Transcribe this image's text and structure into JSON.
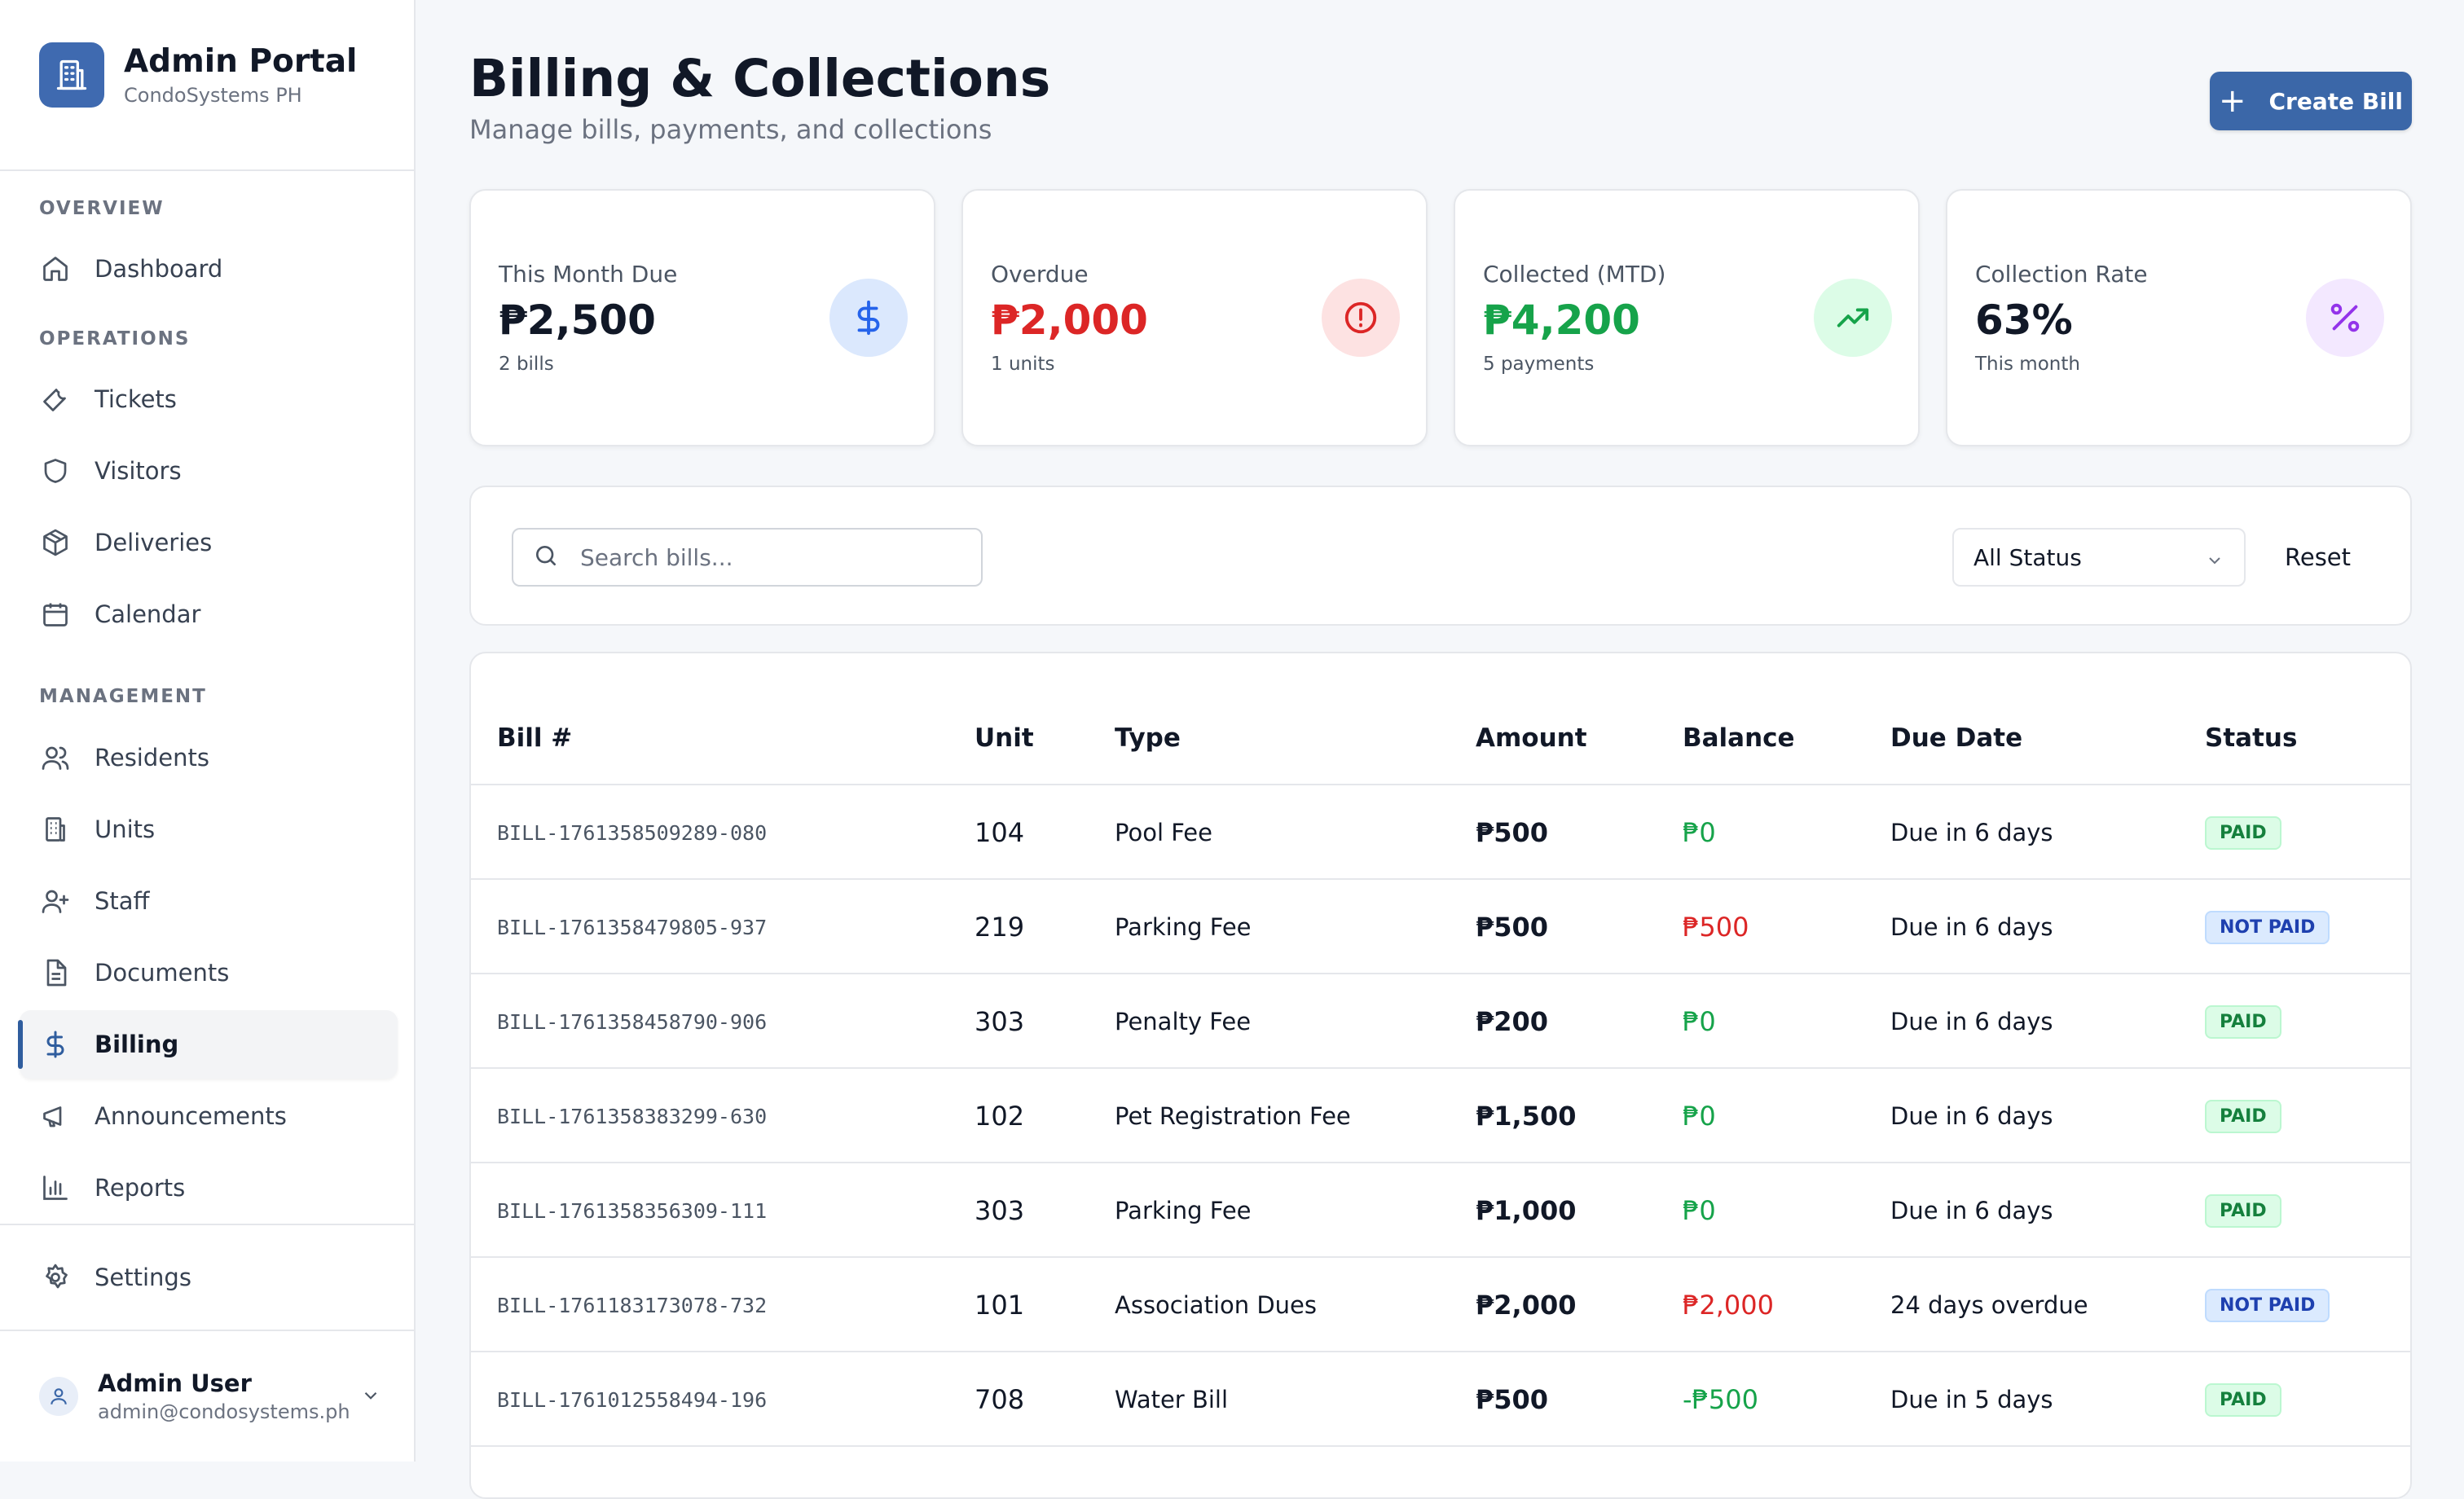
{
  "brand": {
    "title": "Admin Portal",
    "subtitle": "CondoSystems PH",
    "icon": "building-icon",
    "color": "#3f6ab0"
  },
  "sidebar": {
    "sections": [
      "OVERVIEW",
      "OPERATIONS",
      "MANAGEMENT"
    ],
    "items": [
      {
        "label": "Dashboard",
        "icon": "home-icon"
      },
      {
        "label": "Tickets",
        "icon": "wrench-icon"
      },
      {
        "label": "Visitors",
        "icon": "shield-icon"
      },
      {
        "label": "Deliveries",
        "icon": "package-icon"
      },
      {
        "label": "Calendar",
        "icon": "calendar-icon"
      },
      {
        "label": "Residents",
        "icon": "users-icon"
      },
      {
        "label": "Units",
        "icon": "building-icon"
      },
      {
        "label": "Staff",
        "icon": "user-plus-icon"
      },
      {
        "label": "Documents",
        "icon": "document-icon"
      },
      {
        "label": "Billing",
        "icon": "dollar-icon",
        "active": true
      },
      {
        "label": "Announcements",
        "icon": "megaphone-icon"
      },
      {
        "label": "Reports",
        "icon": "bar-chart-icon"
      },
      {
        "label": "Settings",
        "icon": "gear-icon"
      }
    ],
    "user": {
      "name": "Admin User",
      "email": "admin@condosystems.ph"
    }
  },
  "header": {
    "title": "Billing & Collections",
    "subtitle": "Manage bills, payments, and collections",
    "create_label": "Create Bill"
  },
  "stats": [
    {
      "label": "This Month Due",
      "value": "₱2,500",
      "sub": "2 bills",
      "icon": "dollar-icon",
      "color": "#111827",
      "icon_bg": "#dbe8fd",
      "icon_color": "#2563eb"
    },
    {
      "label": "Overdue",
      "value": "₱2,000",
      "sub": "1 units",
      "icon": "alert-circle-icon",
      "color": "#dc2626",
      "icon_bg": "#fde2e2",
      "icon_color": "#dc2626"
    },
    {
      "label": "Collected (MTD)",
      "value": "₱4,200",
      "sub": "5 payments",
      "icon": "trending-up-icon",
      "color": "#16a34a",
      "icon_bg": "#dcfce7",
      "icon_color": "#16a34a"
    },
    {
      "label": "Collection Rate",
      "value": "63%",
      "sub": "This month",
      "icon": "percent-icon",
      "color": "#111827",
      "icon_bg": "#f3e8ff",
      "icon_color": "#9333ea"
    }
  ],
  "filters": {
    "search_placeholder": "Search bills...",
    "status_value": "All Status",
    "reset_label": "Reset"
  },
  "table": {
    "headers": [
      "Bill #",
      "Unit",
      "Type",
      "Amount",
      "Balance",
      "Due Date",
      "Status"
    ],
    "rows": [
      {
        "bill": "BILL-1761358509289-080",
        "unit": "104",
        "type": "Pool Fee",
        "amount": "₱500",
        "balance": "₱0",
        "balance_color": "#16a34a",
        "due": "Due in 6 days",
        "status": "PAID"
      },
      {
        "bill": "BILL-1761358479805-937",
        "unit": "219",
        "type": "Parking Fee",
        "amount": "₱500",
        "balance": "₱500",
        "balance_color": "#dc2626",
        "due": "Due in 6 days",
        "status": "NOT PAID"
      },
      {
        "bill": "BILL-1761358458790-906",
        "unit": "303",
        "type": "Penalty Fee",
        "amount": "₱200",
        "balance": "₱0",
        "balance_color": "#16a34a",
        "due": "Due in 6 days",
        "status": "PAID"
      },
      {
        "bill": "BILL-1761358383299-630",
        "unit": "102",
        "type": "Pet Registration Fee",
        "amount": "₱1,500",
        "balance": "₱0",
        "balance_color": "#16a34a",
        "due": "Due in 6 days",
        "status": "PAID"
      },
      {
        "bill": "BILL-1761358356309-111",
        "unit": "303",
        "type": "Parking Fee",
        "amount": "₱1,000",
        "balance": "₱0",
        "balance_color": "#16a34a",
        "due": "Due in 6 days",
        "status": "PAID"
      },
      {
        "bill": "BILL-1761183173078-732",
        "unit": "101",
        "type": "Association Dues",
        "amount": "₱2,000",
        "balance": "₱2,000",
        "balance_color": "#dc2626",
        "due": "24 days overdue",
        "status": "NOT PAID"
      },
      {
        "bill": "BILL-1761012558494-196",
        "unit": "708",
        "type": "Water Bill",
        "amount": "₱500",
        "balance": "-₱500",
        "balance_color": "#16a34a",
        "due": "Due in 5 days",
        "status": "PAID"
      }
    ]
  }
}
